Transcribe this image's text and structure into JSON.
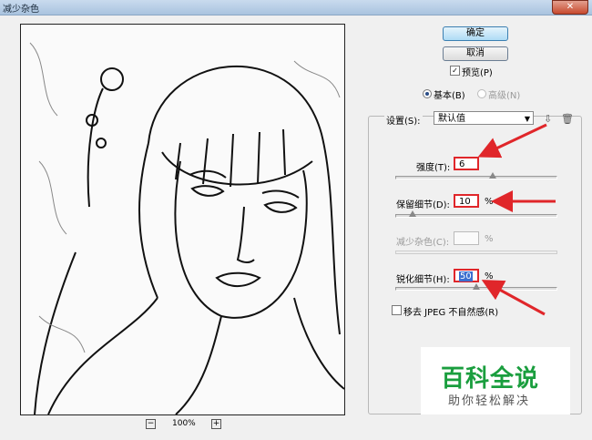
{
  "window": {
    "title": "减少杂色",
    "close_label": "✕"
  },
  "preview": {
    "zoom": "100%",
    "zoom_out": "−",
    "zoom_in": "+"
  },
  "buttons": {
    "ok": "确定",
    "cancel": "取消"
  },
  "preview_toggle": {
    "label": "预览(P)",
    "checked": true
  },
  "mode": {
    "basic": "基本(B)",
    "advanced": "高级(N)",
    "selected": "basic"
  },
  "settings": {
    "label": "设置(S):",
    "value": "默认值"
  },
  "controls": [
    {
      "label": "强度(T):",
      "value": "6",
      "unit": "",
      "slider_fraction": 0.6
    },
    {
      "label": "保留细节(D):",
      "value": "10",
      "unit": "%",
      "slider_fraction": 0.1
    },
    {
      "label": "减少杂色(C):",
      "value": "",
      "unit": "%",
      "slider_fraction": null,
      "disabled": true
    },
    {
      "label": "锐化细节(H):",
      "value": "50",
      "unit": "%",
      "slider_fraction": 0.5
    }
  ],
  "jpeg": {
    "label": "移去 JPEG 不自然感(R)",
    "checked": false
  },
  "watermark": {
    "title": "百科全说",
    "subtitle": "助你轻松解决"
  },
  "colors": {
    "annotation_red": "#e0262a",
    "ok_blue": "#aedbf5",
    "watermark_green": "#1a9e3e"
  }
}
